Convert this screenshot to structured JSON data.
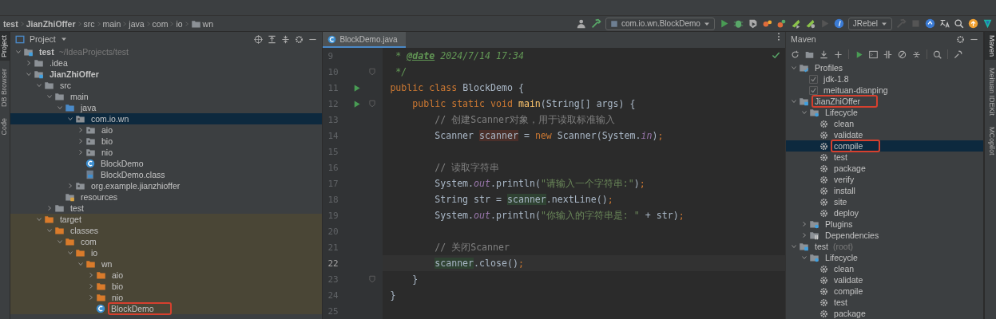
{
  "breadcrumbs": [
    {
      "label": "test",
      "bold": true
    },
    {
      "label": "JianZhiOffer",
      "bold": true
    },
    {
      "label": "src",
      "bold": false
    },
    {
      "label": "main",
      "bold": false
    },
    {
      "label": "java",
      "bold": false
    },
    {
      "label": "com",
      "bold": false
    },
    {
      "label": "io",
      "bold": false
    },
    {
      "label": "wn",
      "bold": false
    }
  ],
  "toolbar": {
    "run_config": "com.io.wn.BlockDemo",
    "plugin_config": "JRebel"
  },
  "left_tabs": [
    {
      "label": "Project",
      "selected": true
    },
    {
      "label": "DB Browser",
      "selected": false
    },
    {
      "label": "Code",
      "selected": false
    }
  ],
  "project": {
    "title": "Project",
    "tree": [
      {
        "label": "test",
        "hint": "~/IdeaProjects/test",
        "kind": "module",
        "bold": true,
        "expanded": true,
        "selected": false,
        "marked": false,
        "excluded": false,
        "children": [
          {
            "label": ".idea",
            "kind": "folder",
            "bold": false,
            "expanded": false,
            "selected": false,
            "marked": false,
            "excluded": false
          },
          {
            "label": "JianZhiOffer",
            "kind": "module",
            "bold": true,
            "expanded": true,
            "selected": false,
            "marked": false,
            "excluded": false,
            "children": [
              {
                "label": "src",
                "kind": "folder",
                "bold": false,
                "expanded": true,
                "selected": false,
                "marked": false,
                "excluded": false,
                "children": [
                  {
                    "label": "main",
                    "kind": "folder",
                    "bold": false,
                    "expanded": true,
                    "selected": false,
                    "marked": false,
                    "excluded": false,
                    "children": [
                      {
                        "label": "java",
                        "kind": "source",
                        "bold": false,
                        "expanded": true,
                        "selected": false,
                        "marked": false,
                        "excluded": false,
                        "children": [
                          {
                            "label": "com.io.wn",
                            "kind": "package",
                            "bold": false,
                            "expanded": true,
                            "selected": true,
                            "marked": false,
                            "excluded": false,
                            "children": [
                              {
                                "label": "aio",
                                "kind": "package",
                                "bold": false,
                                "expanded": false,
                                "selected": false,
                                "marked": false,
                                "excluded": false
                              },
                              {
                                "label": "bio",
                                "kind": "package",
                                "bold": false,
                                "expanded": false,
                                "selected": false,
                                "marked": false,
                                "excluded": false
                              },
                              {
                                "label": "nio",
                                "kind": "package",
                                "bold": false,
                                "expanded": false,
                                "selected": false,
                                "marked": false,
                                "excluded": false
                              },
                              {
                                "label": "BlockDemo",
                                "kind": "class",
                                "bold": false,
                                "selected": false,
                                "marked": false,
                                "excluded": false
                              },
                              {
                                "label": "BlockDemo.class",
                                "kind": "classfile",
                                "bold": false,
                                "selected": false,
                                "marked": false,
                                "excluded": false
                              }
                            ]
                          },
                          {
                            "label": "org.example.jianzhioffer",
                            "kind": "package",
                            "bold": false,
                            "expanded": false,
                            "selected": false,
                            "marked": false,
                            "excluded": false
                          }
                        ]
                      },
                      {
                        "label": "resources",
                        "kind": "resources",
                        "bold": false,
                        "selected": false,
                        "marked": false,
                        "excluded": false
                      }
                    ]
                  },
                  {
                    "label": "test",
                    "kind": "folder",
                    "bold": false,
                    "expanded": false,
                    "selected": false,
                    "marked": false,
                    "excluded": false
                  }
                ]
              },
              {
                "label": "target",
                "kind": "excluded-folder",
                "bold": false,
                "expanded": true,
                "selected": false,
                "marked": false,
                "excluded": true,
                "children": [
                  {
                    "label": "classes",
                    "kind": "excluded-folder",
                    "bold": false,
                    "expanded": true,
                    "selected": false,
                    "marked": false,
                    "excluded": true,
                    "children": [
                      {
                        "label": "com",
                        "kind": "excluded-folder",
                        "bold": false,
                        "expanded": true,
                        "selected": false,
                        "marked": false,
                        "excluded": true,
                        "children": [
                          {
                            "label": "io",
                            "kind": "excluded-folder",
                            "bold": false,
                            "expanded": true,
                            "selected": false,
                            "marked": false,
                            "excluded": true,
                            "children": [
                              {
                                "label": "wn",
                                "kind": "excluded-folder",
                                "bold": false,
                                "expanded": true,
                                "selected": false,
                                "marked": false,
                                "excluded": true,
                                "children": [
                                  {
                                    "label": "aio",
                                    "kind": "excluded-folder",
                                    "bold": false,
                                    "expanded": false,
                                    "selected": false,
                                    "marked": false,
                                    "excluded": true
                                  },
                                  {
                                    "label": "bio",
                                    "kind": "excluded-folder",
                                    "bold": false,
                                    "expanded": false,
                                    "selected": false,
                                    "marked": false,
                                    "excluded": true
                                  },
                                  {
                                    "label": "nio",
                                    "kind": "excluded-folder",
                                    "bold": false,
                                    "expanded": false,
                                    "selected": false,
                                    "marked": false,
                                    "excluded": true
                                  },
                                  {
                                    "label": "BlockDemo",
                                    "kind": "class",
                                    "bold": false,
                                    "selected": false,
                                    "marked": true,
                                    "excluded": true
                                  }
                                ]
                              }
                            ]
                          }
                        ]
                      }
                    ]
                  }
                ]
              }
            ]
          }
        ]
      }
    ]
  },
  "editor": {
    "tab": {
      "label": "BlockDemo.java",
      "selected": true
    },
    "lines": [
      {
        "number": "9",
        "current": false,
        "run_button": false,
        "fold_marker": false,
        "tokens": [
          {
            "text": " * ",
            "kind": "doc"
          },
          {
            "text": "@date",
            "kind": "doctag"
          },
          {
            "text": " 2024/7/14 17:34",
            "kind": "doc"
          }
        ]
      },
      {
        "number": "10",
        "current": false,
        "run_button": false,
        "fold_marker": true,
        "tokens": [
          {
            "text": " */",
            "kind": "doc"
          }
        ]
      },
      {
        "number": "11",
        "current": false,
        "run_button": true,
        "fold_marker": false,
        "tokens": [
          {
            "text": "public class ",
            "kind": "keyword"
          },
          {
            "text": "BlockDemo {",
            "kind": "plain"
          }
        ]
      },
      {
        "number": "12",
        "current": false,
        "run_button": true,
        "fold_marker": true,
        "tokens": [
          {
            "text": "    public static void ",
            "kind": "keyword"
          },
          {
            "text": "main",
            "kind": "method"
          },
          {
            "text": "(String[] args) {",
            "kind": "plain"
          }
        ]
      },
      {
        "number": "13",
        "current": false,
        "run_button": false,
        "fold_marker": false,
        "tokens": [
          {
            "text": "        // 创建Scanner对象，用于读取标准输入",
            "kind": "comment"
          }
        ]
      },
      {
        "number": "14",
        "current": false,
        "run_button": false,
        "fold_marker": false,
        "tokens": [
          {
            "text": "        Scanner ",
            "kind": "plain"
          },
          {
            "text": "scanner",
            "kind": "write-usage"
          },
          {
            "text": " = ",
            "kind": "plain"
          },
          {
            "text": "new ",
            "kind": "keyword"
          },
          {
            "text": "Scanner(System.",
            "kind": "plain"
          },
          {
            "text": "in",
            "kind": "field"
          },
          {
            "text": ")",
            "kind": "plain"
          },
          {
            "text": ";",
            "kind": "keyword"
          }
        ]
      },
      {
        "number": "15",
        "current": false,
        "run_button": false,
        "fold_marker": false
      },
      {
        "number": "16",
        "current": false,
        "run_button": false,
        "fold_marker": false,
        "tokens": [
          {
            "text": "        // 读取字符串",
            "kind": "comment"
          }
        ]
      },
      {
        "number": "17",
        "current": false,
        "run_button": false,
        "fold_marker": false,
        "tokens": [
          {
            "text": "        System.",
            "kind": "plain"
          },
          {
            "text": "out",
            "kind": "field"
          },
          {
            "text": ".println(",
            "kind": "plain"
          },
          {
            "text": "\"请输入一个字符串:\"",
            "kind": "string"
          },
          {
            "text": ")",
            "kind": "plain"
          },
          {
            "text": ";",
            "kind": "keyword"
          }
        ]
      },
      {
        "number": "18",
        "current": false,
        "run_button": false,
        "fold_marker": false,
        "tokens": [
          {
            "text": "        String str = ",
            "kind": "plain"
          },
          {
            "text": "scanner",
            "kind": "read-usage"
          },
          {
            "text": ".nextLine()",
            "kind": "plain"
          },
          {
            "text": ";",
            "kind": "keyword"
          }
        ]
      },
      {
        "number": "19",
        "current": false,
        "run_button": false,
        "fold_marker": false,
        "tokens": [
          {
            "text": "        System.",
            "kind": "plain"
          },
          {
            "text": "out",
            "kind": "field"
          },
          {
            "text": ".println(",
            "kind": "plain"
          },
          {
            "text": "\"你输入的字符串是: \"",
            "kind": "string"
          },
          {
            "text": " + str)",
            "kind": "plain"
          },
          {
            "text": ";",
            "kind": "keyword"
          }
        ]
      },
      {
        "number": "20",
        "current": false,
        "run_button": false,
        "fold_marker": false
      },
      {
        "number": "21",
        "current": false,
        "run_button": false,
        "fold_marker": false,
        "tokens": [
          {
            "text": "        // 关闭Scanner",
            "kind": "comment"
          }
        ]
      },
      {
        "number": "22",
        "current": true,
        "run_button": false,
        "fold_marker": false,
        "tokens": [
          {
            "text": "        scanner",
            "kind": "read-usage"
          },
          {
            "text": ".close()",
            "kind": "plain"
          },
          {
            "text": ";",
            "kind": "keyword"
          }
        ]
      },
      {
        "number": "23",
        "current": false,
        "run_button": false,
        "fold_marker": true,
        "tokens": [
          {
            "text": "    }",
            "kind": "plain"
          }
        ]
      },
      {
        "number": "24",
        "current": false,
        "run_button": false,
        "fold_marker": false,
        "tokens": [
          {
            "text": "}",
            "kind": "plain"
          }
        ]
      },
      {
        "number": "25",
        "current": false,
        "run_button": false,
        "fold_marker": false
      }
    ]
  },
  "maven": {
    "title": "Maven",
    "tree": [
      {
        "label": "Profiles",
        "kind": "profiles",
        "expanded": true,
        "selected": false,
        "marked": false,
        "children": [
          {
            "label": "jdk-1.8",
            "kind": "checkbox",
            "checked": true,
            "selected": false,
            "marked": false
          },
          {
            "label": "meituan-dianping",
            "kind": "checkbox",
            "checked": true,
            "selected": false,
            "marked": false
          }
        ]
      },
      {
        "label": "JianZhiOffer",
        "kind": "module",
        "expanded": true,
        "selected": false,
        "marked": true,
        "children": [
          {
            "label": "Lifecycle",
            "kind": "lifecycle",
            "expanded": true,
            "selected": false,
            "marked": false,
            "children": [
              {
                "label": "clean",
                "kind": "goal",
                "selected": false,
                "marked": false
              },
              {
                "label": "validate",
                "kind": "goal",
                "selected": false,
                "marked": false
              },
              {
                "label": "compile",
                "kind": "goal",
                "selected": true,
                "marked": true
              },
              {
                "label": "test",
                "kind": "goal",
                "selected": false,
                "marked": false
              },
              {
                "label": "package",
                "kind": "goal",
                "selected": false,
                "marked": false
              },
              {
                "label": "verify",
                "kind": "goal",
                "selected": false,
                "marked": false
              },
              {
                "label": "install",
                "kind": "goal",
                "selected": false,
                "marked": false
              },
              {
                "label": "site",
                "kind": "goal",
                "selected": false,
                "marked": false
              },
              {
                "label": "deploy",
                "kind": "goal",
                "selected": false,
                "marked": false
              }
            ]
          },
          {
            "label": "Plugins",
            "kind": "lifecycle",
            "expanded": false,
            "selected": false,
            "marked": false
          },
          {
            "label": "Dependencies",
            "kind": "deps",
            "expanded": false,
            "selected": false,
            "marked": false
          }
        ]
      },
      {
        "label": "test",
        "hint": "(root)",
        "kind": "module",
        "expanded": true,
        "selected": false,
        "marked": false,
        "children": [
          {
            "label": "Lifecycle",
            "kind": "lifecycle",
            "expanded": true,
            "selected": false,
            "marked": false,
            "children": [
              {
                "label": "clean",
                "kind": "goal",
                "selected": false,
                "marked": false
              },
              {
                "label": "validate",
                "kind": "goal",
                "selected": false,
                "marked": false
              },
              {
                "label": "compile",
                "kind": "goal",
                "selected": false,
                "marked": false
              },
              {
                "label": "test",
                "kind": "goal",
                "selected": false,
                "marked": false
              },
              {
                "label": "package",
                "kind": "goal",
                "selected": false,
                "marked": false
              }
            ]
          }
        ]
      }
    ]
  },
  "right_tabs": [
    {
      "label": "Maven",
      "selected": true
    },
    {
      "label": "Meituan IDEKit",
      "selected": false
    },
    {
      "label": "MCopilot",
      "selected": false
    }
  ]
}
